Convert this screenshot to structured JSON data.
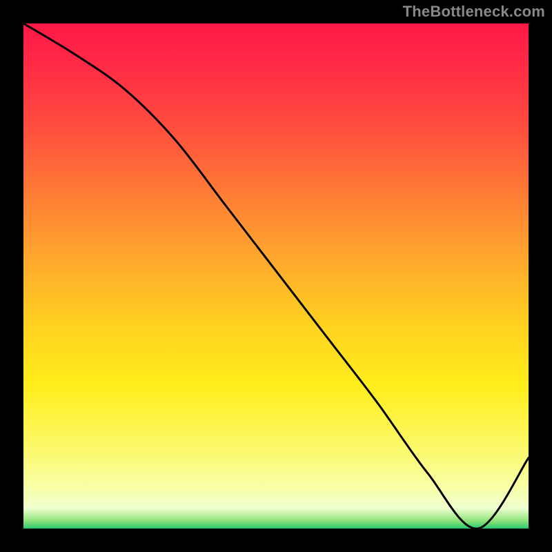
{
  "watermark": "TheBottleneck.com",
  "chart_data": {
    "type": "line",
    "title": "",
    "xlabel": "",
    "ylabel": "",
    "xlim": [
      0,
      100
    ],
    "ylim": [
      0,
      100
    ],
    "x": [
      0,
      10,
      20,
      30,
      40,
      50,
      60,
      70,
      80,
      90,
      100
    ],
    "values": [
      100,
      94,
      87,
      77,
      64,
      51,
      38,
      25,
      11,
      0,
      14
    ],
    "gradient_stops": [
      {
        "pct": 0,
        "color": "#ff1846"
      },
      {
        "pct": 8,
        "color": "#ff2a46"
      },
      {
        "pct": 20,
        "color": "#ff4c3f"
      },
      {
        "pct": 33,
        "color": "#ff7a36"
      },
      {
        "pct": 46,
        "color": "#ffa62e"
      },
      {
        "pct": 60,
        "color": "#ffd21f"
      },
      {
        "pct": 72,
        "color": "#ffee1c"
      },
      {
        "pct": 84,
        "color": "#fcf96a"
      },
      {
        "pct": 92,
        "color": "#f8ffa8"
      },
      {
        "pct": 96,
        "color": "#eeffd0"
      },
      {
        "pct": 98.5,
        "color": "#8de27a"
      },
      {
        "pct": 100,
        "color": "#28c76f"
      }
    ],
    "minimum_x_band": [
      78,
      90
    ],
    "minimum_label": ""
  },
  "colors": {
    "watermark": "#888888",
    "frame": "#000000",
    "curve": "#000000",
    "xlabel": "#cf2b2b"
  }
}
